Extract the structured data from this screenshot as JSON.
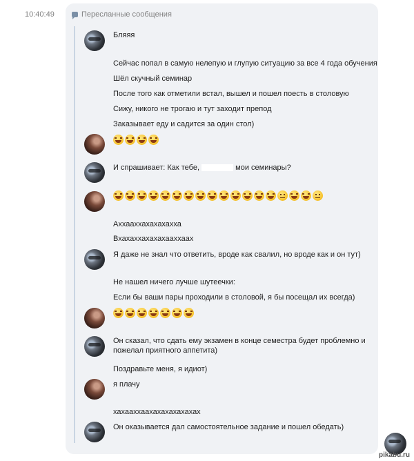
{
  "message": {
    "time": "10:40:49"
  },
  "forwarded": {
    "header": "Пересланные сообщения"
  },
  "lines": {
    "l1": "Бляяя",
    "l2": "Сейчас попал в самую нелепую и глупую ситуацию за все 4 года обучения",
    "l3": "Шёл скучный семинар",
    "l4": "После того как отметили встал, вышел и пошел поесть в столовую",
    "l5": "Сижу, никого не трогаю и тут заходит препод",
    "l6": "Заказывает еду и садится за один стол)",
    "l7a": "И спрашивает: Как тебе,",
    "l7b": "мои семинары?",
    "l8": "Аххааххахахахахха",
    "l9": "Вхахаххахахахааххаах",
    "l10": "Я даже не знал что ответить, вроде как свалил, но вроде как и он тут)",
    "l11": "Не нашел ничего лучше шутеечки:",
    "l12": "Если бы ваши пары проходили в столовой, я бы посещал их всегда)",
    "l13a": "Он сказал, что сдать ему экзамен в конце семестра будет проблемно и",
    "l13b": "пожелал приятного аппетита)",
    "l14": "Поздравьте меня, я идиот)",
    "l15": "я плачу",
    "l16": "хахааххаахахахахахахах",
    "l17": "Он оказывается дал самостоятельное задание и пошел обедать)"
  },
  "emoji_rows": {
    "r1": [
      "laugh",
      "laugh",
      "laugh",
      "laugh"
    ],
    "r2": [
      "laugh",
      "laugh",
      "laugh",
      "laugh",
      "laugh",
      "laugh",
      "laugh",
      "laugh",
      "laugh",
      "laugh",
      "laugh",
      "laugh",
      "laugh",
      "laugh",
      "neutral",
      "laugh",
      "laugh",
      "neutral"
    ],
    "r3": [
      "laugh",
      "laugh",
      "laugh",
      "laugh",
      "laugh",
      "laugh",
      "laugh"
    ]
  },
  "watermark": "pikabu.ru"
}
